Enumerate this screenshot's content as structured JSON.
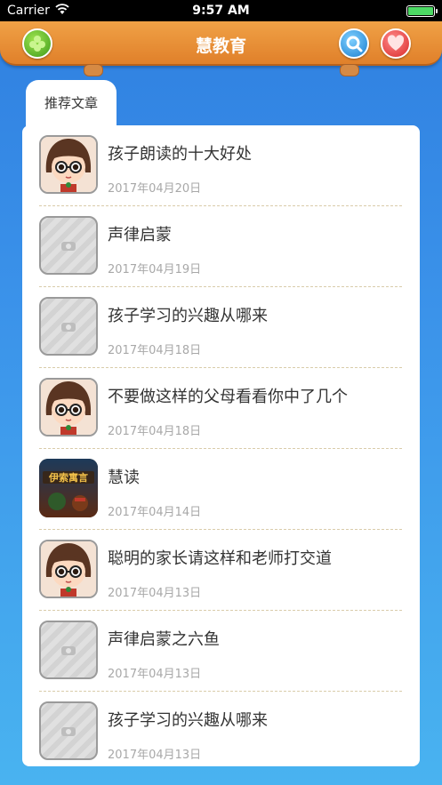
{
  "status_bar": {
    "carrier": "Carrier",
    "time": "9:57 AM",
    "battery_color": "#4cd964"
  },
  "nav": {
    "title": "慧教育",
    "left_icon": "add-icon",
    "right_icons": [
      "search-icon",
      "heart-icon"
    ],
    "colors": {
      "bar": "#e0802a",
      "add": "#3e9b1a",
      "search": "#1b7fd0",
      "favorite": "#d92a2a"
    }
  },
  "tab": {
    "label": "推荐文章"
  },
  "articles": [
    {
      "title": "孩子朗读的十大好处",
      "date": "2017年04月20日",
      "thumb": "girl-avatar"
    },
    {
      "title": "声律启蒙",
      "date": "2017年04月19日",
      "thumb": "placeholder"
    },
    {
      "title": "孩子学习的兴趣从哪来",
      "date": "2017年04月18日",
      "thumb": "placeholder"
    },
    {
      "title": "不要做这样的父母看看你中了几个",
      "date": "2017年04月18日",
      "thumb": "girl-avatar"
    },
    {
      "title": "慧读",
      "date": "2017年04月14日",
      "thumb": "book-cover"
    },
    {
      "title": "聪明的家长请这样和老师打交道",
      "date": "2017年04月13日",
      "thumb": "girl-avatar"
    },
    {
      "title": "声律启蒙之六鱼",
      "date": "2017年04月13日",
      "thumb": "placeholder"
    },
    {
      "title": "孩子学习的兴趣从哪来",
      "date": "2017年04月13日",
      "thumb": "placeholder"
    }
  ],
  "book_cover_text": "伊索寓言"
}
